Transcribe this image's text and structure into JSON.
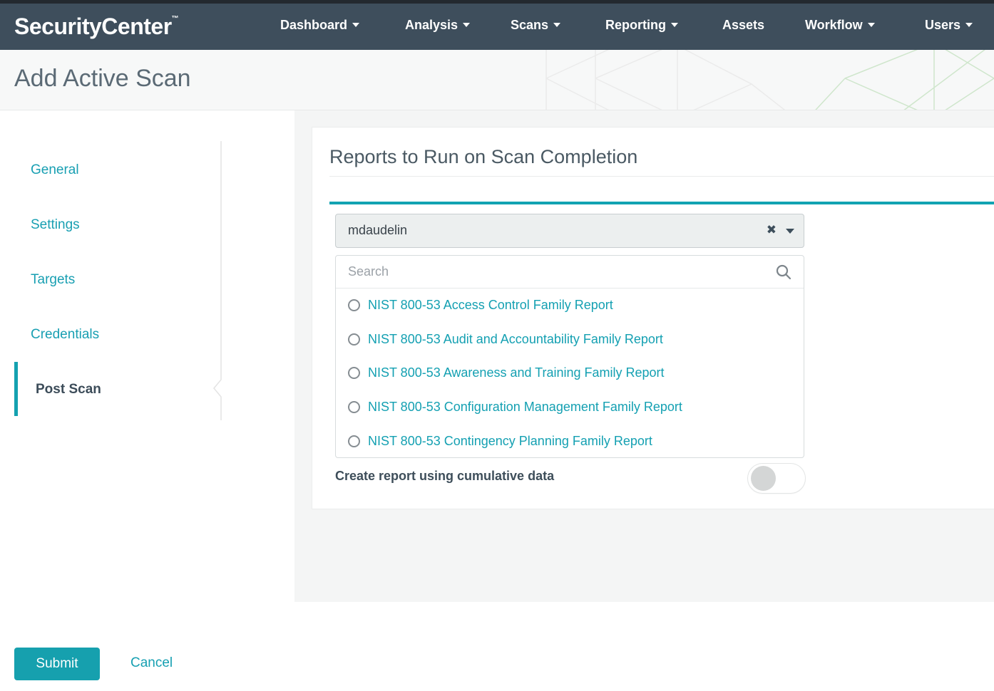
{
  "nav": {
    "logo": "SecurityCenter",
    "logo_tm": "™",
    "items": [
      {
        "label": "Dashboard",
        "caret": true
      },
      {
        "label": "Analysis",
        "caret": true
      },
      {
        "label": "Scans",
        "caret": true
      },
      {
        "label": "Reporting",
        "caret": true
      },
      {
        "label": "Assets",
        "caret": false
      },
      {
        "label": "Workflow",
        "caret": true
      },
      {
        "label": "Users",
        "caret": true
      }
    ]
  },
  "page": {
    "title": "Add Active Scan"
  },
  "sidebar": {
    "items": [
      {
        "label": "General",
        "active": false
      },
      {
        "label": "Settings",
        "active": false
      },
      {
        "label": "Targets",
        "active": false
      },
      {
        "label": "Credentials",
        "active": false
      },
      {
        "label": "Post Scan",
        "active": true
      }
    ]
  },
  "main": {
    "section_title": "Reports to Run on Scan Completion",
    "report_select": {
      "value": "mdaudelin"
    },
    "search": {
      "placeholder": "Search",
      "value": ""
    },
    "report_options": [
      "NIST 800-53 Access Control Family Report",
      "NIST 800-53 Audit and Accountability Family Report",
      "NIST 800-53 Awareness and Training Family Report",
      "NIST 800-53 Configuration Management Family Report",
      "NIST 800-53 Contingency Planning Family Report"
    ],
    "cumulative_toggle": {
      "label": "Create report using cumulative data",
      "state": "off"
    }
  },
  "footer": {
    "submit_label": "Submit",
    "cancel_label": "Cancel"
  },
  "icons": {
    "clear": "✖",
    "caret_down": "triangle-down",
    "search": "magnifier",
    "option": "radio-circle"
  },
  "colors": {
    "accent_teal": "#14a1b0",
    "navbar_bg": "#3e4e5c",
    "link_teal": "#17a0b2",
    "active_text": "#3c4c59"
  }
}
